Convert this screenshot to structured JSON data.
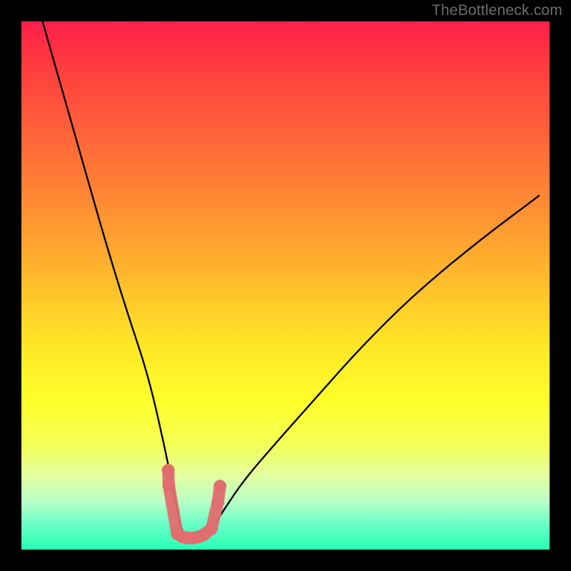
{
  "watermark": "TheBottleneck.com",
  "chart_data": {
    "type": "line",
    "title": "",
    "xlabel": "",
    "ylabel": "",
    "xlim": [
      0,
      100
    ],
    "ylim": [
      0,
      100
    ],
    "grid": false,
    "legend": false,
    "vertex_x": 32,
    "series": [
      {
        "name": "bottleneck-curve",
        "color": "#000000",
        "x": [
          4,
          8,
          12,
          16,
          20,
          24,
          27,
          29,
          30,
          31,
          32,
          34,
          36,
          38,
          42,
          48,
          56,
          64,
          74,
          86,
          98
        ],
        "values": [
          100,
          86,
          72,
          58,
          45,
          33,
          20,
          10,
          5,
          2,
          1,
          2,
          4,
          7,
          13,
          20,
          29,
          38,
          48,
          58,
          67
        ]
      },
      {
        "name": "data-points",
        "color": "#E16E6E",
        "type": "scatter",
        "x": [
          27.8,
          27.9,
          29.5,
          30.5,
          31.5,
          32.5,
          33.5,
          34.5,
          36.0,
          37.2,
          37.6
        ],
        "values": [
          15.0,
          12.2,
          3.0,
          2.4,
          2.2,
          2.2,
          2.4,
          2.8,
          4.0,
          9.0,
          12.0
        ]
      }
    ]
  }
}
